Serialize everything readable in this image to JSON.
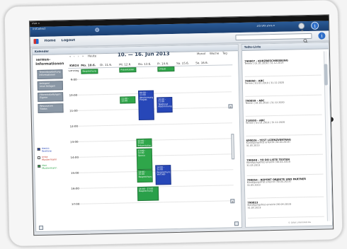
{
  "status_bar": {
    "carrier": "iPad ≈",
    "time": "16.06.2013"
  },
  "app": {
    "name": "iniCollect",
    "nav_home": "Home",
    "nav_logout": "Logout"
  },
  "left_panel": {
    "header": "Kalender",
    "section_title": "Termin-\nInformationen",
    "side_buttons": [
      "Terminbearbeitung\nInformationen",
      "Anlegen/\nneue Anlagen",
      "Filtereinstellungen\nEigene",
      "Ressourcen\nStatus"
    ],
    "toolbar": {
      "nav_glyphs": [
        "«",
        "‹",
        "›",
        "»"
      ],
      "today": "Heute",
      "title": "10. — 16. Jun 2013"
    },
    "views": [
      "Monat",
      "Woche",
      "Tag"
    ],
    "week_label": "KW24",
    "allday_label": "Ganztag",
    "days": [
      "Mo. 10.6.",
      "Di. 11.6.",
      "Mi. 12.6.",
      "Do. 13.6.",
      "Fr. 14.6.",
      "Sa. 15.6.",
      "So. 16.6."
    ],
    "hours": [
      "9:00",
      "10:00",
      "11:00",
      "12:00",
      "13:00",
      "14:00",
      "15:00",
      "16:00",
      "17:00"
    ],
    "legend": [
      {
        "label": "Meine Termine",
        "checked": true,
        "color": "#2747b8"
      },
      {
        "label": "Erika\nMustermann",
        "checked": false,
        "color": "#c0392b"
      },
      {
        "label": "Max\nMustermann",
        "checked": true,
        "color": "#2fa64a"
      }
    ],
    "allday_events": [
      {
        "label": "Besprechung",
        "color": "green"
      },
      {
        "label": "Präsentation",
        "color": "green"
      },
      {
        "label": "Urlaub",
        "color": "green"
      }
    ],
    "events": [
      {
        "label": "11:00 - 12:00\nMeeting",
        "color": "green"
      },
      {
        "label": "09:00 - 11:00\nAbstimmung\nProjekt",
        "color": "blue"
      },
      {
        "label": "10:00 - 11:00\nTelefonat\nAbstimmung",
        "color": "blue"
      },
      {
        "label": "12:00 - 13:00\nPräsentation",
        "color": "green"
      },
      {
        "label": "13:00 - 14:00\nTermin",
        "color": "green"
      },
      {
        "label": "14:00 - 15:00\nBesprechung",
        "color": "green"
      },
      {
        "label": "14:00 - 15:00\nBesprechung\nVertrieb",
        "color": "blue"
      },
      {
        "label": "16:00 - 17:00\nBesprechung",
        "color": "green"
      }
    ]
  },
  "right_panel": {
    "header": "ToDo-Liste",
    "items": [
      {
        "title": "790007 - KURZBESCHREIBUNG",
        "sub": "Termin | 01.01.2010 | 31.12.2014"
      },
      {
        "title": "790050 - ABC",
        "sub": "Termin | 01.01.2010 | 31.12.2020"
      },
      {
        "title": "790059 - ABC",
        "sub": "Termin | 01.01.2010 | 31.12.2020"
      },
      {
        "title": "710030 - ABC",
        "sub": "Termin | 01.01.2010 | 31.12.2020"
      },
      {
        "title": "690026 - TEST LIZENZVERTRAG",
        "sub": "Kündigungsfrist erreicht (30.04.2013)\n31.05.2013"
      },
      {
        "title": "790048 - TO DO LISTE TESTEN",
        "sub": "Kündigungsfrist erreicht (30.04.2013)\n31.05.2013"
      },
      {
        "title": "790054 - REPORT OBJEKTE UND PARTNER",
        "sub": "Kündigungsfrist erreicht (30.04.2013)\n31.05.2013"
      },
      {
        "title": "790023",
        "sub": "Kündigungsfrist erreicht (30.04.2013)\n31.05.2013"
      }
    ],
    "footer": "© Orbit Unlimited AG"
  },
  "icons": [
    "app-logo-icon",
    "search-icon",
    "gear-icon",
    "info-icon",
    "checkbox-icon",
    "expand-icon"
  ]
}
